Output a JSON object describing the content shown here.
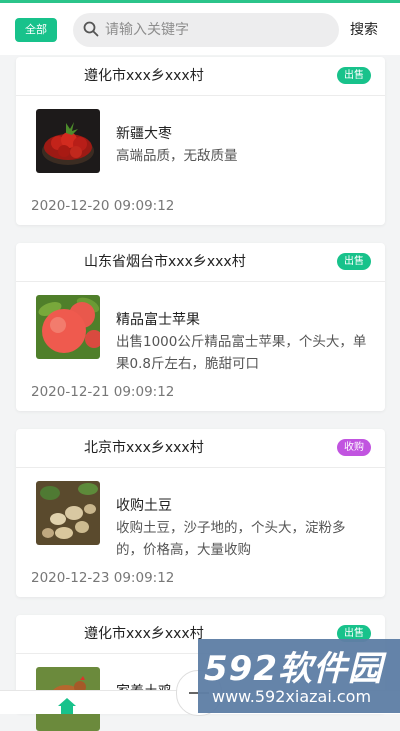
{
  "header": {
    "all_label": "全部",
    "search_placeholder": "请输入关键字",
    "search_button": "搜索"
  },
  "colors": {
    "accent": "#18c28b",
    "buy_badge": "#c154e0"
  },
  "cards": [
    {
      "location": "遵化市xxx乡xxx村",
      "badge": "出售",
      "badge_type": "sell",
      "title": "新疆大枣",
      "description": "高端品质，无敌质量",
      "date": "2020-12-20 09:09:12",
      "image": "red-dates-photo"
    },
    {
      "location": "山东省烟台市xxx乡xxx村",
      "badge": "出售",
      "badge_type": "sell",
      "title": "精品富士苹果",
      "description": "出售1000公斤精品富士苹果，个头大，单果0.8斤左右，脆甜可口",
      "date": "2020-12-21 09:09:12",
      "image": "apple-photo"
    },
    {
      "location": "北京市xxx乡xxx村",
      "badge": "收购",
      "badge_type": "buy",
      "title": "收购土豆",
      "description": "收购土豆，沙子地的，个头大，淀粉多的，价格高，大量收购",
      "date": "2020-12-23 09:09:12",
      "image": "potato-photo"
    },
    {
      "location": "遵化市xxx乡xxx村",
      "badge": "出售",
      "badge_type": "sell",
      "title": "家养土鸡",
      "image": "chicken-photo"
    }
  ],
  "watermark": {
    "brand": "592软件园",
    "url": "www.592xiazai.com"
  },
  "nav": {
    "home_icon": "home-icon"
  }
}
